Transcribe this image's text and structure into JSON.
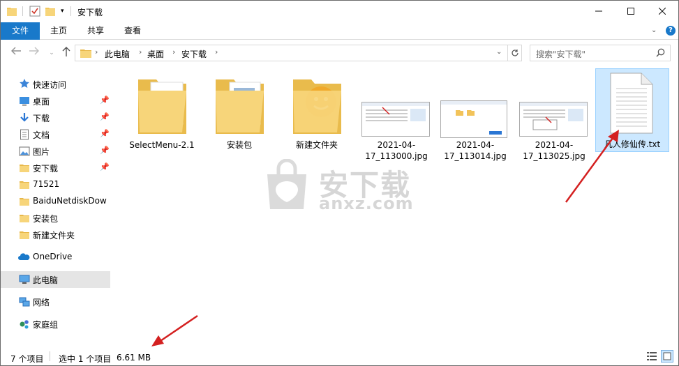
{
  "window": {
    "title": "安下载"
  },
  "ribbon": {
    "tabs": [
      "文件",
      "主页",
      "共享",
      "查看"
    ]
  },
  "address": {
    "crumbs": [
      "此电脑",
      "桌面",
      "安下载"
    ],
    "search_placeholder": "搜索\"安下载\""
  },
  "nav": {
    "quick_access": "快速访问",
    "items": [
      {
        "label": "桌面",
        "pinned": true
      },
      {
        "label": "下载",
        "pinned": true
      },
      {
        "label": "文档",
        "pinned": true
      },
      {
        "label": "图片",
        "pinned": true
      },
      {
        "label": "安下载",
        "pinned": true
      },
      {
        "label": "71521",
        "pinned": false
      },
      {
        "label": "BaiduNetdiskDow",
        "pinned": false
      },
      {
        "label": "安装包",
        "pinned": false
      },
      {
        "label": "新建文件夹",
        "pinned": false
      }
    ],
    "onedrive": "OneDrive",
    "this_pc": "此电脑",
    "network": "网络",
    "homegroup": "家庭组"
  },
  "files": [
    {
      "name": "SelectMenu-2.1",
      "type": "folder-app"
    },
    {
      "name": "安装包",
      "type": "folder-docs"
    },
    {
      "name": "新建文件夹",
      "type": "folder-face"
    },
    {
      "name": "2021-04-17_113000.jpg",
      "type": "image"
    },
    {
      "name": "2021-04-17_113014.jpg",
      "type": "image"
    },
    {
      "name": "2021-04-17_113025.jpg",
      "type": "image"
    },
    {
      "name": "凡人修仙传.txt",
      "type": "text",
      "selected": true
    }
  ],
  "watermark": {
    "text_big": "安下载",
    "text_small": "anxz.com"
  },
  "status": {
    "count": "7 个项目",
    "selected": "选中 1 个项目",
    "size": "6.61 MB"
  },
  "colors": {
    "accent": "#1979ca",
    "selection": "#cce8ff",
    "arrow": "#d42020",
    "folder": "#f7d57a"
  }
}
